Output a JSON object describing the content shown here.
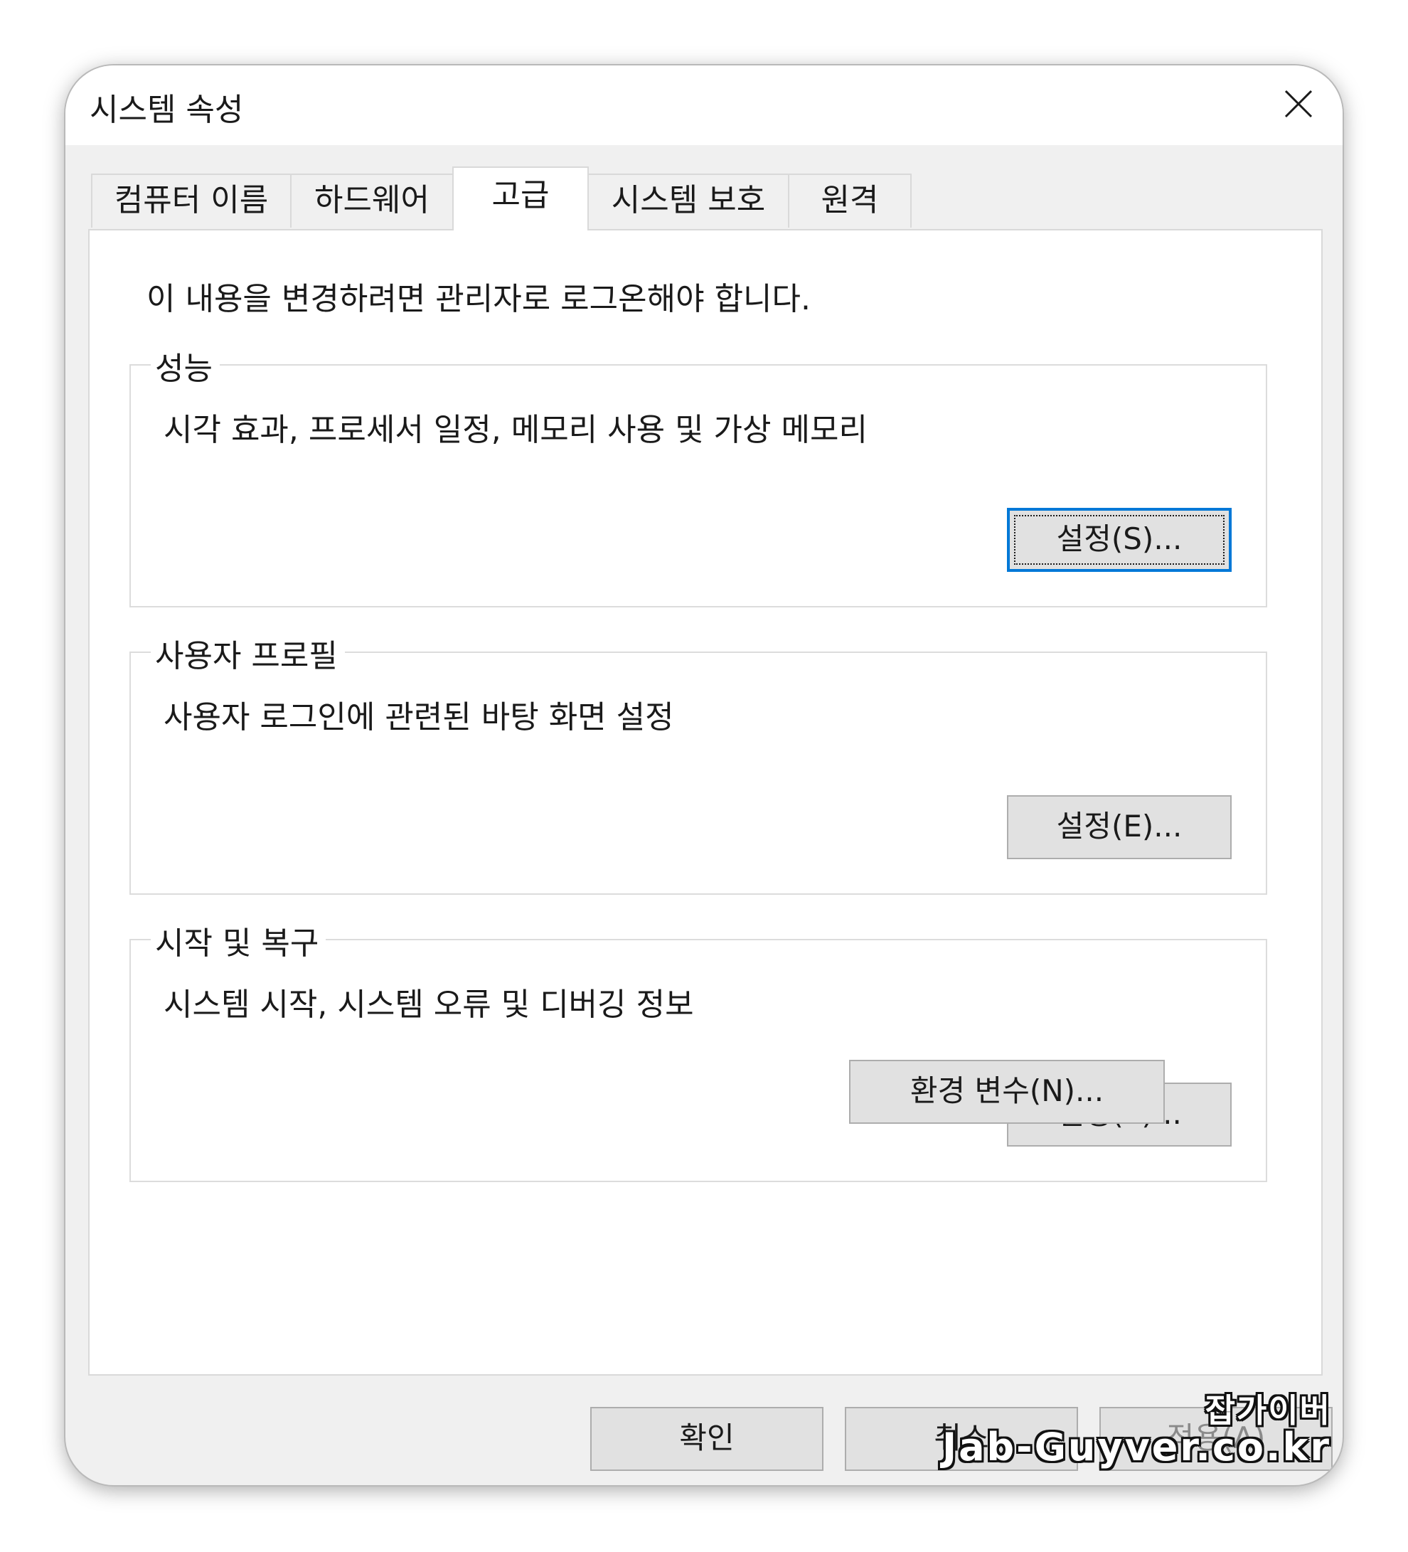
{
  "window": {
    "title": "시스템 속성",
    "close_icon": "close-icon"
  },
  "tabs": [
    {
      "label": "컴퓨터 이름",
      "active": false
    },
    {
      "label": "하드웨어",
      "active": false
    },
    {
      "label": "고급",
      "active": true
    },
    {
      "label": "시스템 보호",
      "active": false
    },
    {
      "label": "원격",
      "active": false
    }
  ],
  "notice": "이 내용을 변경하려면 관리자로 로그온해야 합니다.",
  "groups": {
    "performance": {
      "title": "성능",
      "description": "시각 효과, 프로세서 일정, 메모리 사용 및 가상 메모리",
      "button_label": "설정(S)...",
      "focused": true
    },
    "user_profiles": {
      "title": "사용자 프로필",
      "description": "사용자 로그인에 관련된 바탕 화면 설정",
      "button_label": "설정(E)..."
    },
    "startup_recovery": {
      "title": "시작 및 복구",
      "description": "시스템 시작, 시스템 오류 및 디버깅 정보",
      "button_label": "설정(T)..."
    }
  },
  "env_button_label": "환경 변수(N)...",
  "footer": {
    "ok_label": "확인",
    "cancel_label": "취소",
    "apply_label": "적용(A)"
  },
  "watermark": {
    "line1": "잡가이버",
    "line2": "Jab-Guyver.co.kr"
  },
  "colors": {
    "focus_border": "#0078d7",
    "dialog_background": "#f0f0f0",
    "button_face": "#e1e1e1"
  }
}
